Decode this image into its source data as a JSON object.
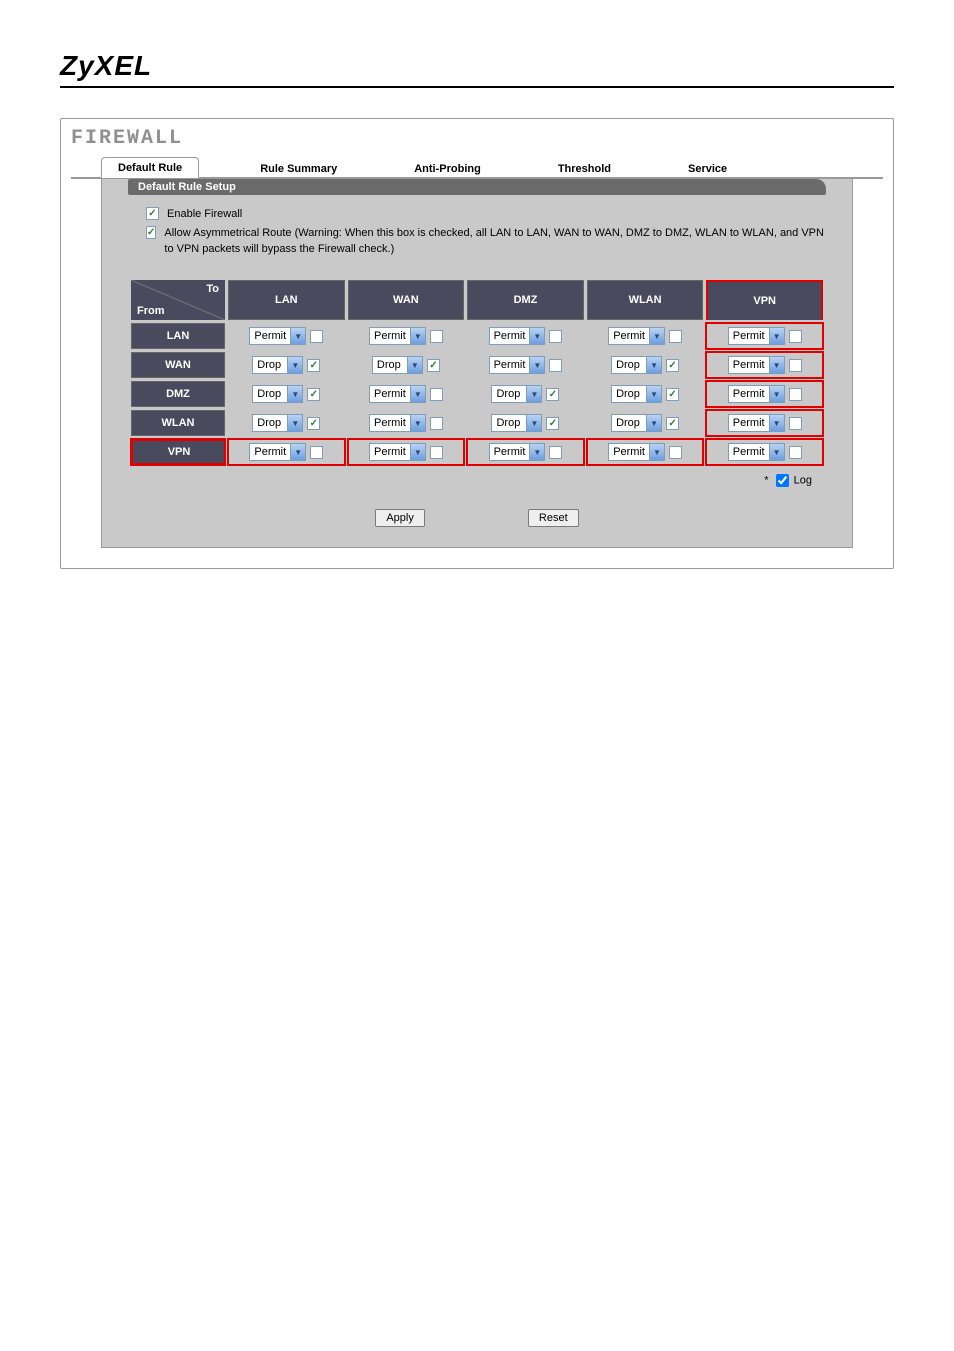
{
  "logo": "ZyXEL",
  "page_title": "FIREWALL",
  "tabs": [
    {
      "label": "Default Rule",
      "active": true
    },
    {
      "label": "Rule Summary",
      "active": false
    },
    {
      "label": "Anti-Probing",
      "active": false
    },
    {
      "label": "Threshold",
      "active": false
    },
    {
      "label": "Service",
      "active": false
    }
  ],
  "section_title": "Default Rule Setup",
  "checks": {
    "enable_firewall": {
      "label": "Enable Firewall",
      "checked": true
    },
    "asym_route": {
      "label": "Allow Asymmetrical Route (Warning: When this box is checked, all LAN to LAN, WAN to WAN, DMZ to DMZ, WLAN to WLAN, and VPN to VPN packets will bypass the Firewall check.)",
      "checked": true
    }
  },
  "corner": {
    "to": "To",
    "from": "From"
  },
  "col_heads": [
    "LAN",
    "WAN",
    "DMZ",
    "WLAN",
    "VPN"
  ],
  "rows": [
    {
      "name": "LAN",
      "cells": [
        {
          "action": "Permit",
          "chk": false
        },
        {
          "action": "Permit",
          "chk": false
        },
        {
          "action": "Permit",
          "chk": false
        },
        {
          "action": "Permit",
          "chk": false
        },
        {
          "action": "Permit",
          "chk": false
        }
      ]
    },
    {
      "name": "WAN",
      "cells": [
        {
          "action": "Drop",
          "chk": true
        },
        {
          "action": "Drop",
          "chk": true
        },
        {
          "action": "Permit",
          "chk": false
        },
        {
          "action": "Drop",
          "chk": true
        },
        {
          "action": "Permit",
          "chk": false
        }
      ]
    },
    {
      "name": "DMZ",
      "cells": [
        {
          "action": "Drop",
          "chk": true
        },
        {
          "action": "Permit",
          "chk": false
        },
        {
          "action": "Drop",
          "chk": true
        },
        {
          "action": "Drop",
          "chk": true
        },
        {
          "action": "Permit",
          "chk": false
        }
      ]
    },
    {
      "name": "WLAN",
      "cells": [
        {
          "action": "Drop",
          "chk": true
        },
        {
          "action": "Permit",
          "chk": false
        },
        {
          "action": "Drop",
          "chk": true
        },
        {
          "action": "Drop",
          "chk": true
        },
        {
          "action": "Permit",
          "chk": false
        }
      ]
    },
    {
      "name": "VPN",
      "cells": [
        {
          "action": "Permit",
          "chk": false
        },
        {
          "action": "Permit",
          "chk": false
        },
        {
          "action": "Permit",
          "chk": false
        },
        {
          "action": "Permit",
          "chk": false
        },
        {
          "action": "Permit",
          "chk": false
        }
      ]
    }
  ],
  "log": {
    "prefix": "*",
    "label": "Log",
    "checked": true
  },
  "buttons": {
    "apply": "Apply",
    "reset": "Reset"
  }
}
